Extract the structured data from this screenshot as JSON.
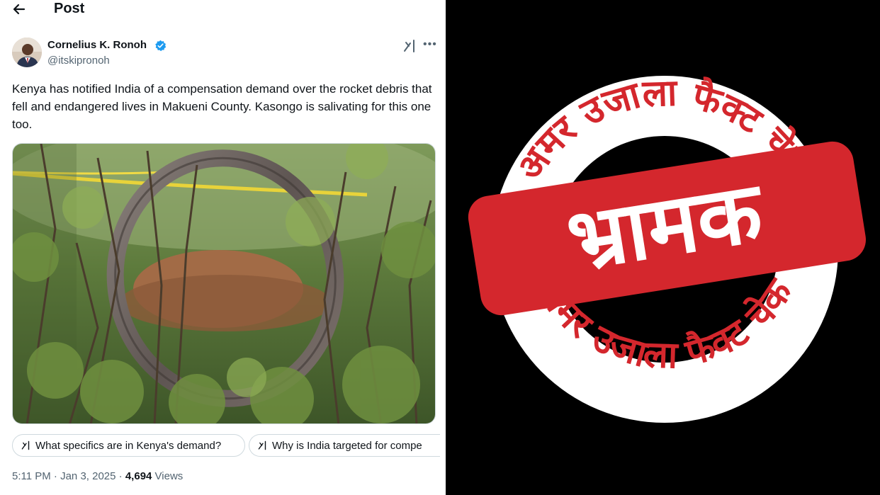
{
  "header": {
    "title": "Post"
  },
  "author": {
    "name": "Cornelius K. Ronoh",
    "handle": "@itskipronoh"
  },
  "tweet": {
    "text": "Kenya has notified India of a compensation demand over the rocket debris that fell and endangered lives in Makueni County. Kasongo is salivating for this one too."
  },
  "suggestions": [
    {
      "label": "What specifics are in Kenya's demand?"
    },
    {
      "label": "Why is India targeted for compe"
    }
  ],
  "meta": {
    "time": "5:11 PM",
    "separator1": " · ",
    "date": "Jan 3, 2025",
    "separator2": " · ",
    "views_count": "4,694",
    "views_label": " Views"
  },
  "stamp": {
    "top_arc_text": "अमर उजाला फैक्ट चेक",
    "bottom_arc_text": "अमर उजाला फैक्ट चेक",
    "verdict": "भ्रामक",
    "colors": {
      "red": "#d4272d",
      "ring": "#ffffff",
      "background": "#000000"
    }
  },
  "icons": [
    "back-arrow-icon",
    "verified-badge-icon",
    "grok-icon",
    "more-options-icon"
  ],
  "colors": {
    "text_primary": "#0f1419",
    "text_secondary": "#536471",
    "verified_blue": "#1d9bf0",
    "border": "#cfd9de"
  }
}
